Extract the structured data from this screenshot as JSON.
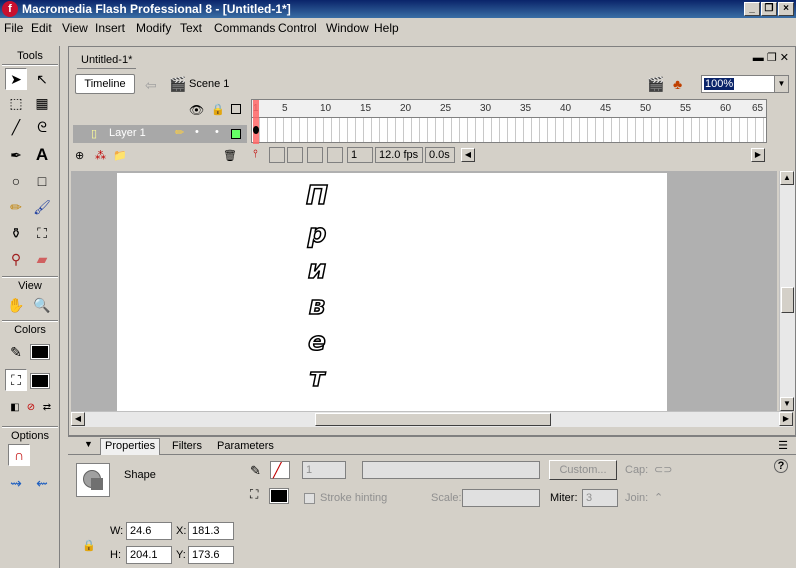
{
  "app": {
    "title": "Macromedia Flash Professional 8 - [Untitled-1*]",
    "icon_letter": "f",
    "window_controls": [
      "_",
      "❐",
      "×"
    ]
  },
  "menu": [
    "File",
    "Edit",
    "View",
    "Insert",
    "Modify",
    "Text",
    "Commands",
    "Control",
    "Window",
    "Help"
  ],
  "tools": {
    "header": "Tools",
    "view_header": "View",
    "colors_header": "Colors",
    "options_header": "Options"
  },
  "document": {
    "tab": "Untitled-1*",
    "timeline_button": "Timeline",
    "scene": "Scene 1",
    "zoom": "100%",
    "layer_name": "Layer 1",
    "frame_numbers": [
      "1",
      "5",
      "10",
      "15",
      "20",
      "25",
      "30",
      "35",
      "40",
      "45",
      "50",
      "55",
      "60",
      "65"
    ],
    "current_frame": "1",
    "fps": "12.0 fps",
    "time": "0.0s",
    "stage_letters": [
      "П",
      "р",
      "и",
      "в",
      "е",
      "т"
    ]
  },
  "properties": {
    "tabs": [
      "Properties",
      "Filters",
      "Parameters"
    ],
    "shape_label": "Shape",
    "stroke_size": "1",
    "custom_button": "Custom...",
    "cap_label": "Cap:",
    "stroke_hinting_label": "Stroke hinting",
    "scale_label": "Scale:",
    "miter_label": "Miter:",
    "miter_value": "3",
    "join_label": "Join:",
    "w_label": "W:",
    "w_value": "24.6",
    "h_label": "H:",
    "h_value": "204.1",
    "x_label": "X:",
    "x_value": "181.3",
    "y_label": "Y:",
    "y_value": "173.6",
    "help_icon": "?"
  },
  "colors": {
    "title_bar": "#0a246a",
    "panel_bg": "#d4d0c8",
    "stage_bg": "#ffffff",
    "work_area": "#b0b0b0",
    "layer_selected": "#a8a8a8",
    "playhead": "#ff6666"
  }
}
